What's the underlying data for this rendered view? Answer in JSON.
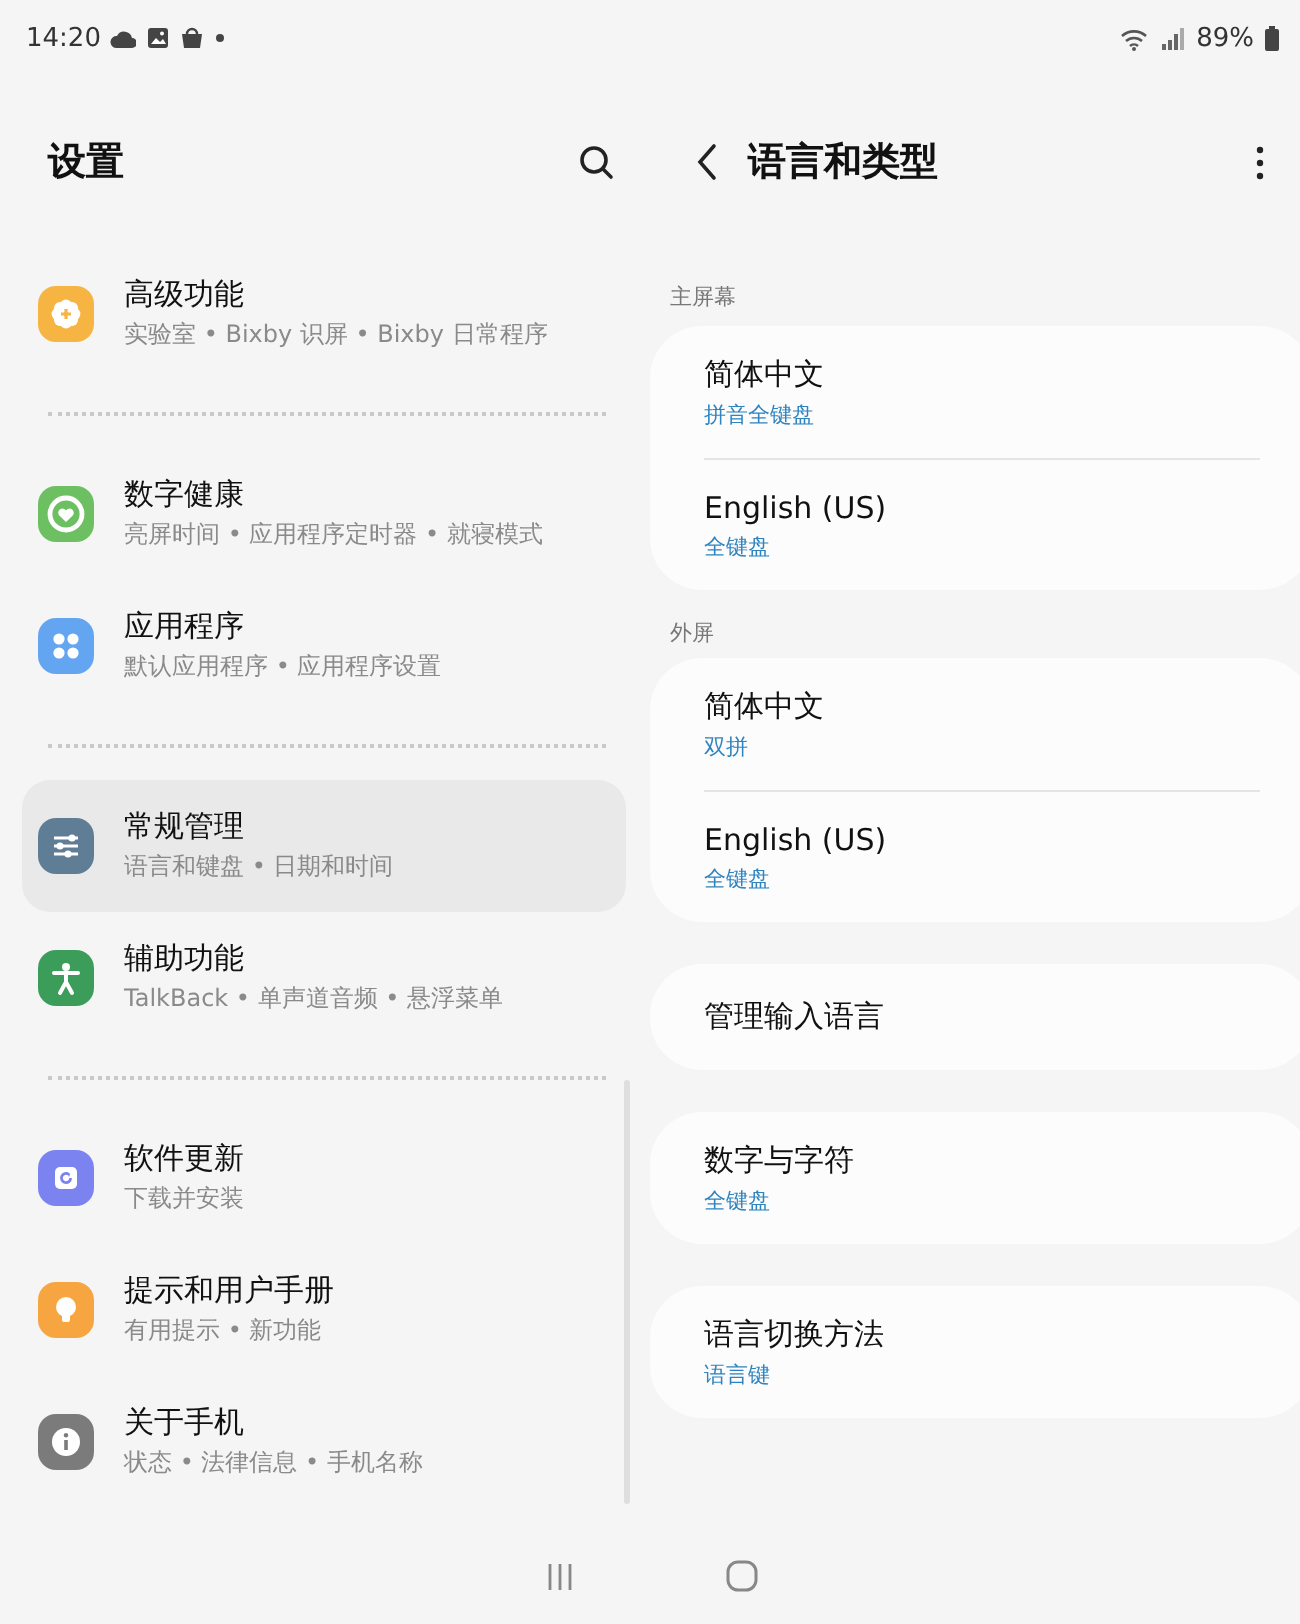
{
  "status_bar": {
    "time": "14:20",
    "battery": "89%"
  },
  "settings": {
    "title": "设置",
    "groups": [
      {
        "items": [
          {
            "title": "高级功能",
            "subtitle": "实验室 • Bixby 识屏 • Bixby 日常程序",
            "color": "#f6b443",
            "selected": false
          }
        ]
      },
      {
        "items": [
          {
            "title": "数字健康",
            "subtitle": "亮屏时间 • 应用程序定时器 • 就寝模式",
            "color": "#6cc061",
            "selected": false
          },
          {
            "title": "应用程序",
            "subtitle": "默认应用程序 • 应用程序设置",
            "color": "#64a5f2",
            "selected": false
          }
        ]
      },
      {
        "items": [
          {
            "title": "常规管理",
            "subtitle": "语言和键盘 • 日期和时间",
            "color": "#5f7d95",
            "selected": true
          },
          {
            "title": "辅助功能",
            "subtitle": "TalkBack • 单声道音频 • 悬浮菜单",
            "color": "#3c9d5a",
            "selected": false
          }
        ]
      },
      {
        "items": [
          {
            "title": "软件更新",
            "subtitle": "下载并安装",
            "color": "#7b83f0",
            "selected": false
          },
          {
            "title": "提示和用户手册",
            "subtitle": "有用提示 • 新功能",
            "color": "#f6a540",
            "selected": false
          },
          {
            "title": "关于手机",
            "subtitle": "状态 • 法律信息 • 手机名称",
            "color": "#7b7b7b",
            "selected": false
          }
        ]
      }
    ]
  },
  "language": {
    "title": "语言和类型",
    "sections": [
      {
        "label": "主屏幕",
        "rows": [
          {
            "title": "简体中文",
            "subtitle": "拼音全键盘"
          },
          {
            "title": "English (US)",
            "subtitle": "全键盘"
          }
        ]
      },
      {
        "label": "外屏",
        "rows": [
          {
            "title": "简体中文",
            "subtitle": "双拼"
          },
          {
            "title": "English (US)",
            "subtitle": "全键盘"
          }
        ]
      },
      {
        "rows": [
          {
            "title": "管理输入语言"
          }
        ]
      },
      {
        "rows": [
          {
            "title": "数字与字符",
            "subtitle": "全键盘"
          }
        ]
      },
      {
        "rows": [
          {
            "title": "语言切换方法",
            "subtitle": "语言键"
          }
        ]
      }
    ]
  }
}
